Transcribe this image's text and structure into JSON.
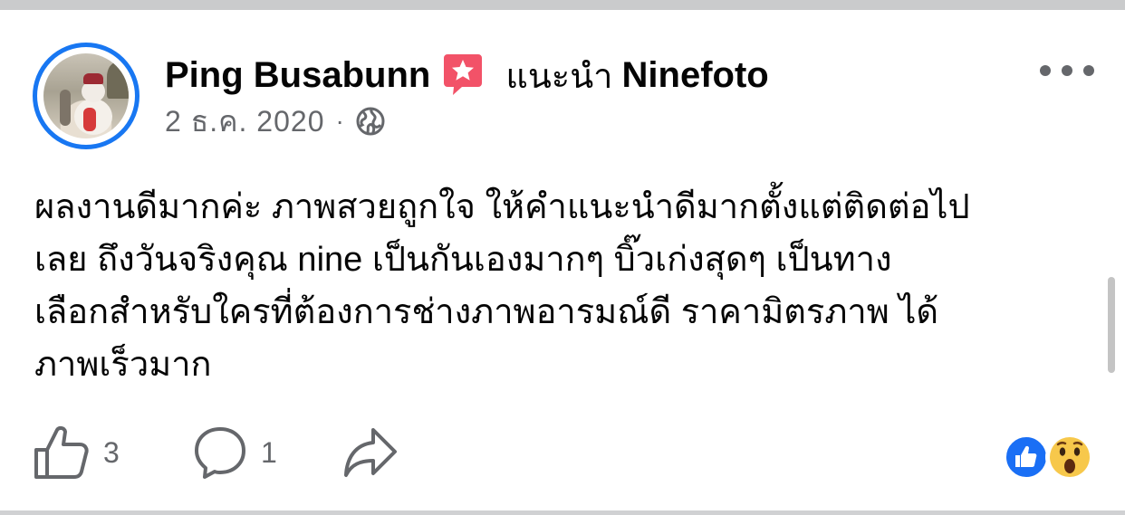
{
  "post": {
    "author": "Ping Busabunn",
    "recommend_text": "แนะนำ",
    "page_name": "Ninefoto",
    "date": "2 ธ.ค. 2020",
    "separator": "·",
    "text_lines": [
      "ผลงานดีมากค่ะ ภาพสวยถูกใจ ให้คำแนะนำดีมากตั้งแต่ติดต่อไป",
      "เลย ถึงวันจริงคุณ nine เป็นกันเองมากๆ บิ๊วเก่งสุดๆ เป็นทาง",
      "เลือกสำหรับใครที่ต้องการช่างภาพอารมณ์ดี ราคามิตรภาพ ได้",
      "ภาพเร็วมาก"
    ]
  },
  "actions": {
    "like_count": "3",
    "comment_count": "1"
  },
  "icons": {
    "recommend": "recommend-star-icon",
    "audience": "globe-icon",
    "more": "more-options-icon",
    "like": "thumbs-up-icon",
    "comment": "comment-bubble-icon",
    "share": "share-arrow-icon",
    "reaction_like": "like-reaction-icon",
    "reaction_wow": "wow-reaction-icon"
  },
  "colors": {
    "accent": "#1877f2",
    "recommend_icon": "#f25268",
    "secondary_text": "#65676b"
  }
}
